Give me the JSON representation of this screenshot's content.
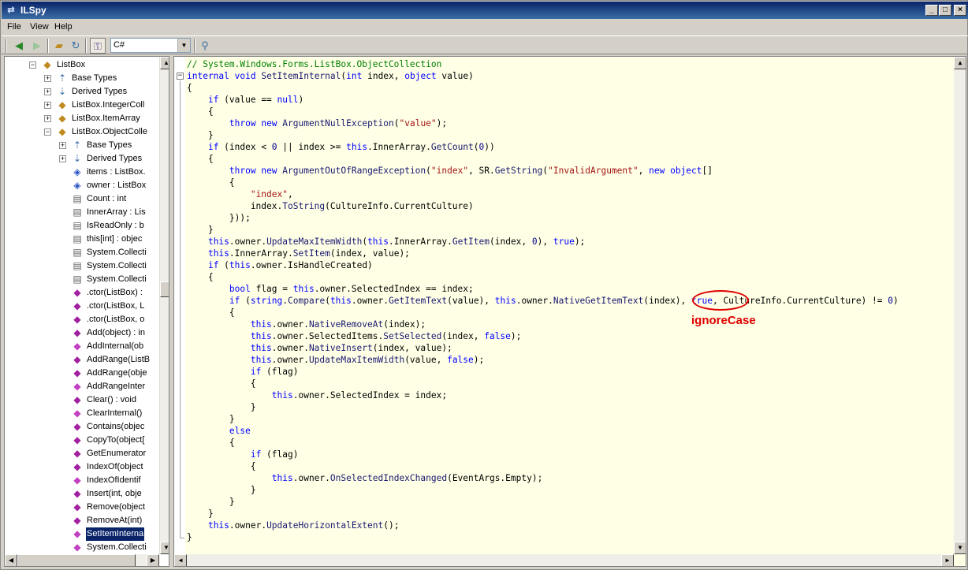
{
  "window": {
    "title": "ILSpy"
  },
  "menu": [
    "File",
    "View",
    "Help"
  ],
  "toolbar": {
    "language": "C#"
  },
  "tree": {
    "items": [
      {
        "label": "ListBox",
        "icon": "class-icon",
        "expander": "−",
        "indent": 0
      },
      {
        "label": "Base Types",
        "icon": "base-types-icon",
        "expander": "+",
        "indent": 1
      },
      {
        "label": "Derived Types",
        "icon": "derived-types-icon",
        "expander": "+",
        "indent": 1
      },
      {
        "label": "ListBox.IntegerColl",
        "icon": "class-icon",
        "expander": "+",
        "indent": 1
      },
      {
        "label": "ListBox.ItemArray",
        "icon": "class-icon",
        "expander": "+",
        "indent": 1
      },
      {
        "label": "ListBox.ObjectColle",
        "icon": "class-icon",
        "expander": "−",
        "indent": 1
      },
      {
        "label": "Base Types",
        "icon": "base-types-icon",
        "expander": "+",
        "indent": 2
      },
      {
        "label": "Derived Types",
        "icon": "derived-types-icon",
        "expander": "+",
        "indent": 2
      },
      {
        "label": "items : ListBox.",
        "icon": "field-icon",
        "expander": "",
        "indent": 2
      },
      {
        "label": "owner : ListBox",
        "icon": "field-icon",
        "expander": "",
        "indent": 2
      },
      {
        "label": "Count : int",
        "icon": "property-icon",
        "expander": "",
        "indent": 2
      },
      {
        "label": "InnerArray : Lis",
        "icon": "property-icon",
        "expander": "",
        "indent": 2
      },
      {
        "label": "IsReadOnly : b",
        "icon": "property-icon",
        "expander": "",
        "indent": 2
      },
      {
        "label": "this[int] : objec",
        "icon": "property-icon",
        "expander": "",
        "indent": 2
      },
      {
        "label": "System.Collecti",
        "icon": "property-icon",
        "expander": "",
        "indent": 2
      },
      {
        "label": "System.Collecti",
        "icon": "property-icon",
        "expander": "",
        "indent": 2
      },
      {
        "label": "System.Collecti",
        "icon": "property-icon",
        "expander": "",
        "indent": 2
      },
      {
        "label": ".ctor(ListBox) :",
        "icon": "method-icon",
        "expander": "",
        "indent": 2
      },
      {
        "label": ".ctor(ListBox, L",
        "icon": "method-icon",
        "expander": "",
        "indent": 2
      },
      {
        "label": ".ctor(ListBox, o",
        "icon": "method-icon",
        "expander": "",
        "indent": 2
      },
      {
        "label": "Add(object) : in",
        "icon": "method-icon",
        "expander": "",
        "indent": 2
      },
      {
        "label": "AddInternal(ob",
        "icon": "private-method-icon",
        "expander": "",
        "indent": 2
      },
      {
        "label": "AddRange(ListB",
        "icon": "method-icon",
        "expander": "",
        "indent": 2
      },
      {
        "label": "AddRange(obje",
        "icon": "method-icon",
        "expander": "",
        "indent": 2
      },
      {
        "label": "AddRangeInter",
        "icon": "private-method-icon",
        "expander": "",
        "indent": 2
      },
      {
        "label": "Clear() : void",
        "icon": "method-icon",
        "expander": "",
        "indent": 2
      },
      {
        "label": "ClearInternal()",
        "icon": "private-method-icon",
        "expander": "",
        "indent": 2
      },
      {
        "label": "Contains(objec",
        "icon": "method-icon",
        "expander": "",
        "indent": 2
      },
      {
        "label": "CopyTo(object[",
        "icon": "method-icon",
        "expander": "",
        "indent": 2
      },
      {
        "label": "GetEnumerator",
        "icon": "method-icon",
        "expander": "",
        "indent": 2
      },
      {
        "label": "IndexOf(object",
        "icon": "method-icon",
        "expander": "",
        "indent": 2
      },
      {
        "label": "IndexOfIdentif",
        "icon": "private-method-icon",
        "expander": "",
        "indent": 2
      },
      {
        "label": "Insert(int, obje",
        "icon": "method-icon",
        "expander": "",
        "indent": 2
      },
      {
        "label": "Remove(object",
        "icon": "method-icon",
        "expander": "",
        "indent": 2
      },
      {
        "label": "RemoveAt(int)",
        "icon": "method-icon",
        "expander": "",
        "indent": 2
      },
      {
        "label": "SetItemInterna",
        "icon": "private-method-icon",
        "expander": "",
        "indent": 2,
        "selected": true
      },
      {
        "label": "System.Collecti",
        "icon": "private-method-icon",
        "expander": "",
        "indent": 2
      }
    ]
  },
  "code": {
    "lines": [
      [
        [
          "cm",
          "// System.Windows.Forms.ListBox.ObjectCollection"
        ]
      ],
      [
        [
          "kw",
          "internal"
        ],
        [
          "ty",
          " "
        ],
        [
          "kw",
          "void"
        ],
        [
          "ty",
          " "
        ],
        [
          "mb",
          "SetItemInternal"
        ],
        [
          "ty",
          "("
        ],
        [
          "kw",
          "int"
        ],
        [
          "ty",
          " index, "
        ],
        [
          "kw",
          "object"
        ],
        [
          "ty",
          " value)"
        ]
      ],
      [
        [
          "ty",
          "{"
        ]
      ],
      [
        [
          "ty",
          "    "
        ],
        [
          "kw",
          "if"
        ],
        [
          "ty",
          " (value == "
        ],
        [
          "kw",
          "null"
        ],
        [
          "ty",
          ")"
        ]
      ],
      [
        [
          "ty",
          "    {"
        ]
      ],
      [
        [
          "ty",
          "        "
        ],
        [
          "kw",
          "throw"
        ],
        [
          "ty",
          " "
        ],
        [
          "kw",
          "new"
        ],
        [
          "ty",
          " "
        ],
        [
          "mb",
          "ArgumentNullException"
        ],
        [
          "ty",
          "("
        ],
        [
          "st",
          "\"value\""
        ],
        [
          "ty",
          ");"
        ]
      ],
      [
        [
          "ty",
          "    }"
        ]
      ],
      [
        [
          "ty",
          "    "
        ],
        [
          "kw",
          "if"
        ],
        [
          "ty",
          " (index < "
        ],
        [
          "num",
          "0"
        ],
        [
          "ty",
          " || index >= "
        ],
        [
          "kw",
          "this"
        ],
        [
          "ty",
          ".InnerArray."
        ],
        [
          "mb",
          "GetCount"
        ],
        [
          "ty",
          "("
        ],
        [
          "num",
          "0"
        ],
        [
          "ty",
          "))"
        ]
      ],
      [
        [
          "ty",
          "    {"
        ]
      ],
      [
        [
          "ty",
          "        "
        ],
        [
          "kw",
          "throw"
        ],
        [
          "ty",
          " "
        ],
        [
          "kw",
          "new"
        ],
        [
          "ty",
          " "
        ],
        [
          "mb",
          "ArgumentOutOfRangeException"
        ],
        [
          "ty",
          "("
        ],
        [
          "st",
          "\"index\""
        ],
        [
          "ty",
          ", SR."
        ],
        [
          "mb",
          "GetString"
        ],
        [
          "ty",
          "("
        ],
        [
          "st",
          "\"InvalidArgument\""
        ],
        [
          "ty",
          ", "
        ],
        [
          "kw",
          "new"
        ],
        [
          "ty",
          " "
        ],
        [
          "kw",
          "object"
        ],
        [
          "ty",
          "[]"
        ]
      ],
      [
        [
          "ty",
          "        {"
        ]
      ],
      [
        [
          "ty",
          "            "
        ],
        [
          "st",
          "\"index\""
        ],
        [
          "ty",
          ","
        ]
      ],
      [
        [
          "ty",
          "            index."
        ],
        [
          "mb",
          "ToString"
        ],
        [
          "ty",
          "(CultureInfo.CurrentCulture)"
        ]
      ],
      [
        [
          "ty",
          "        }));"
        ]
      ],
      [
        [
          "ty",
          "    }"
        ]
      ],
      [
        [
          "ty",
          "    "
        ],
        [
          "kw",
          "this"
        ],
        [
          "ty",
          ".owner."
        ],
        [
          "mb",
          "UpdateMaxItemWidth"
        ],
        [
          "ty",
          "("
        ],
        [
          "kw",
          "this"
        ],
        [
          "ty",
          ".InnerArray."
        ],
        [
          "mb",
          "GetItem"
        ],
        [
          "ty",
          "(index, "
        ],
        [
          "num",
          "0"
        ],
        [
          "ty",
          "), "
        ],
        [
          "kw",
          "true"
        ],
        [
          "ty",
          ");"
        ]
      ],
      [
        [
          "ty",
          "    "
        ],
        [
          "kw",
          "this"
        ],
        [
          "ty",
          ".InnerArray."
        ],
        [
          "mb",
          "SetItem"
        ],
        [
          "ty",
          "(index, value);"
        ]
      ],
      [
        [
          "ty",
          "    "
        ],
        [
          "kw",
          "if"
        ],
        [
          "ty",
          " ("
        ],
        [
          "kw",
          "this"
        ],
        [
          "ty",
          ".owner.IsHandleCreated)"
        ]
      ],
      [
        [
          "ty",
          "    {"
        ]
      ],
      [
        [
          "ty",
          "        "
        ],
        [
          "kw",
          "bool"
        ],
        [
          "ty",
          " flag = "
        ],
        [
          "kw",
          "this"
        ],
        [
          "ty",
          ".owner.SelectedIndex == index;"
        ]
      ],
      [
        [
          "ty",
          "        "
        ],
        [
          "kw",
          "if"
        ],
        [
          "ty",
          " ("
        ],
        [
          "kw",
          "string"
        ],
        [
          "ty",
          "."
        ],
        [
          "mb",
          "Compare"
        ],
        [
          "ty",
          "("
        ],
        [
          "kw",
          "this"
        ],
        [
          "ty",
          ".owner."
        ],
        [
          "mb",
          "GetItemText"
        ],
        [
          "ty",
          "(value), "
        ],
        [
          "kw",
          "this"
        ],
        [
          "ty",
          ".owner."
        ],
        [
          "mb",
          "NativeGetItemText"
        ],
        [
          "ty",
          "(index), "
        ],
        [
          "kw",
          "true"
        ],
        [
          "ty",
          ", CultureInfo.CurrentCulture) != "
        ],
        [
          "num",
          "0"
        ],
        [
          "ty",
          ")"
        ]
      ],
      [
        [
          "ty",
          "        {"
        ]
      ],
      [
        [
          "ty",
          "            "
        ],
        [
          "kw",
          "this"
        ],
        [
          "ty",
          ".owner."
        ],
        [
          "mb",
          "NativeRemoveAt"
        ],
        [
          "ty",
          "(index);"
        ]
      ],
      [
        [
          "ty",
          "            "
        ],
        [
          "kw",
          "this"
        ],
        [
          "ty",
          ".owner.SelectedItems."
        ],
        [
          "mb",
          "SetSelected"
        ],
        [
          "ty",
          "(index, "
        ],
        [
          "kw",
          "false"
        ],
        [
          "ty",
          ");"
        ]
      ],
      [
        [
          "ty",
          "            "
        ],
        [
          "kw",
          "this"
        ],
        [
          "ty",
          ".owner."
        ],
        [
          "mb",
          "NativeInsert"
        ],
        [
          "ty",
          "(index, value);"
        ]
      ],
      [
        [
          "ty",
          "            "
        ],
        [
          "kw",
          "this"
        ],
        [
          "ty",
          ".owner."
        ],
        [
          "mb",
          "UpdateMaxItemWidth"
        ],
        [
          "ty",
          "(value, "
        ],
        [
          "kw",
          "false"
        ],
        [
          "ty",
          ");"
        ]
      ],
      [
        [
          "ty",
          "            "
        ],
        [
          "kw",
          "if"
        ],
        [
          "ty",
          " (flag)"
        ]
      ],
      [
        [
          "ty",
          "            {"
        ]
      ],
      [
        [
          "ty",
          "                "
        ],
        [
          "kw",
          "this"
        ],
        [
          "ty",
          ".owner.SelectedIndex = index;"
        ]
      ],
      [
        [
          "ty",
          "            }"
        ]
      ],
      [
        [
          "ty",
          "        }"
        ]
      ],
      [
        [
          "ty",
          "        "
        ],
        [
          "kw",
          "else"
        ]
      ],
      [
        [
          "ty",
          "        {"
        ]
      ],
      [
        [
          "ty",
          "            "
        ],
        [
          "kw",
          "if"
        ],
        [
          "ty",
          " (flag)"
        ]
      ],
      [
        [
          "ty",
          "            {"
        ]
      ],
      [
        [
          "ty",
          "                "
        ],
        [
          "kw",
          "this"
        ],
        [
          "ty",
          ".owner."
        ],
        [
          "mb",
          "OnSelectedIndexChanged"
        ],
        [
          "ty",
          "(EventArgs.Empty);"
        ]
      ],
      [
        [
          "ty",
          "            }"
        ]
      ],
      [
        [
          "ty",
          "        }"
        ]
      ],
      [
        [
          "ty",
          "    }"
        ]
      ],
      [
        [
          "ty",
          "    "
        ],
        [
          "kw",
          "this"
        ],
        [
          "ty",
          ".owner."
        ],
        [
          "mb",
          "UpdateHorizontalExtent"
        ],
        [
          "ty",
          "();"
        ]
      ],
      [
        [
          "ty",
          "}"
        ]
      ]
    ]
  },
  "annotation": {
    "text": "ignoreCase",
    "color": "#e00000"
  },
  "colors": {
    "keyword": "#0000ff",
    "comment": "#008000",
    "string": "#a31515",
    "background": "#ffffe6",
    "selection": "#0a246a"
  }
}
